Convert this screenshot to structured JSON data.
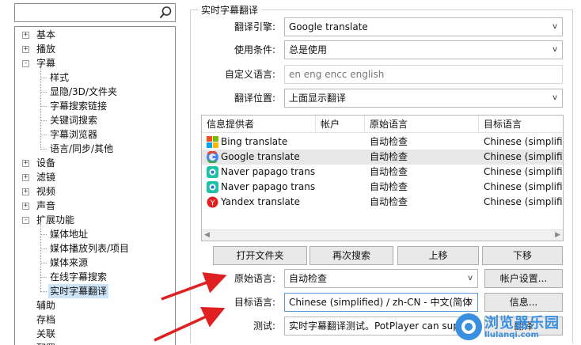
{
  "search": {
    "value": ""
  },
  "tree": [
    {
      "label": "基本",
      "expandable": true,
      "child": false
    },
    {
      "label": "播放",
      "expandable": true,
      "child": false
    },
    {
      "label": "字幕",
      "expandable": true,
      "expanded": true,
      "child": false
    },
    {
      "label": "样式",
      "child": true
    },
    {
      "label": "显隐/3D/文件夹",
      "child": true
    },
    {
      "label": "字幕搜索链接",
      "child": true
    },
    {
      "label": "关键词搜索",
      "child": true
    },
    {
      "label": "字幕浏览器",
      "child": true
    },
    {
      "label": "语言/同步/其他",
      "child": true
    },
    {
      "label": "设备",
      "expandable": true,
      "child": false
    },
    {
      "label": "滤镜",
      "expandable": true,
      "child": false
    },
    {
      "label": "视频",
      "expandable": true,
      "child": false
    },
    {
      "label": "声音",
      "expandable": true,
      "child": false
    },
    {
      "label": "扩展功能",
      "expandable": true,
      "expanded": true,
      "child": false
    },
    {
      "label": "媒体地址",
      "child": true
    },
    {
      "label": "媒体播放列表/项目",
      "child": true
    },
    {
      "label": "媒体来源",
      "child": true
    },
    {
      "label": "在线字幕搜索",
      "child": true
    },
    {
      "label": "实时字幕翻译",
      "child": true,
      "selected": true
    },
    {
      "label": "辅助",
      "child": false
    },
    {
      "label": "存档",
      "child": false
    },
    {
      "label": "关联",
      "child": false
    },
    {
      "label": "配置",
      "child": false
    }
  ],
  "panel": {
    "group_title": "实时字幕翻译",
    "engine_label": "翻译引擎:",
    "engine_value": "Google translate",
    "condition_label": "使用条件:",
    "condition_value": "总是使用",
    "custom_lang_label": "自定义语言:",
    "custom_lang_placeholder": "en eng encc english",
    "position_label": "翻译位置:",
    "position_value": "上面显示翻译"
  },
  "list": {
    "columns": [
      "信息提供者",
      "帐户",
      "原始语言",
      "目标语言"
    ],
    "rows": [
      {
        "provider": "Bing translate",
        "account": "",
        "source": "自动检查",
        "target": "Chinese (simplified",
        "icon": "bing-icon"
      },
      {
        "provider": "Google translate",
        "account": "",
        "source": "自动检查",
        "target": "Chinese (simplified",
        "icon": "google-icon",
        "selected": true
      },
      {
        "provider": "Naver papago transla...",
        "account": "",
        "source": "自动检查",
        "target": "Chinese (simplified",
        "icon": "papago-icon"
      },
      {
        "provider": "Naver papago transla...",
        "account": "",
        "source": "自动检查",
        "target": "Chinese (simplified",
        "icon": "papago-icon"
      },
      {
        "provider": "Yandex translate",
        "account": "",
        "source": "自动检查",
        "target": "Chinese (simplified",
        "icon": "yandex-icon"
      }
    ]
  },
  "buttons": {
    "open_folder": "打开文件夹",
    "search_again": "再次搜索",
    "move_up": "上移",
    "move_down": "下移",
    "account_settings": "帐户设置...",
    "info": "信息...",
    "translate": "翻译"
  },
  "bottom": {
    "source_label": "原始语言:",
    "source_value": "自动检查",
    "target_label": "目标语言:",
    "target_value": "Chinese (simplified) / zh-CN - 中文(简体",
    "test_label": "测试:",
    "test_value": "实时字幕翻译测试。PotPlayer can support"
  },
  "watermark": {
    "text": "浏览器乐园",
    "url": "llulanqi.com"
  },
  "colors": {
    "selection": "#cde3f7",
    "arrow": "#e02020",
    "watermark": "#3a8fe0"
  }
}
